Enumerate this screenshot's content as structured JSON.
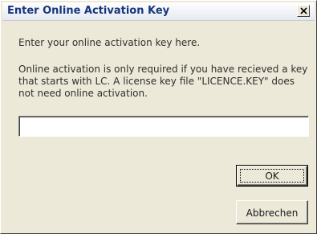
{
  "dialog": {
    "title": "Enter Online Activation Key",
    "close_label": "×",
    "prompt": "Enter your online activation key here.",
    "info": "Online activation is only required if you have recieved a key that starts with LC. A license key file \"LICENCE.KEY\" does not need online activation.",
    "key_value": "",
    "ok_label": "OK",
    "cancel_label": "Abbrechen"
  },
  "colors": {
    "dialog_background": "#ece9d8",
    "title_text": "#15377a"
  },
  "icons": {
    "close": "close-icon"
  }
}
